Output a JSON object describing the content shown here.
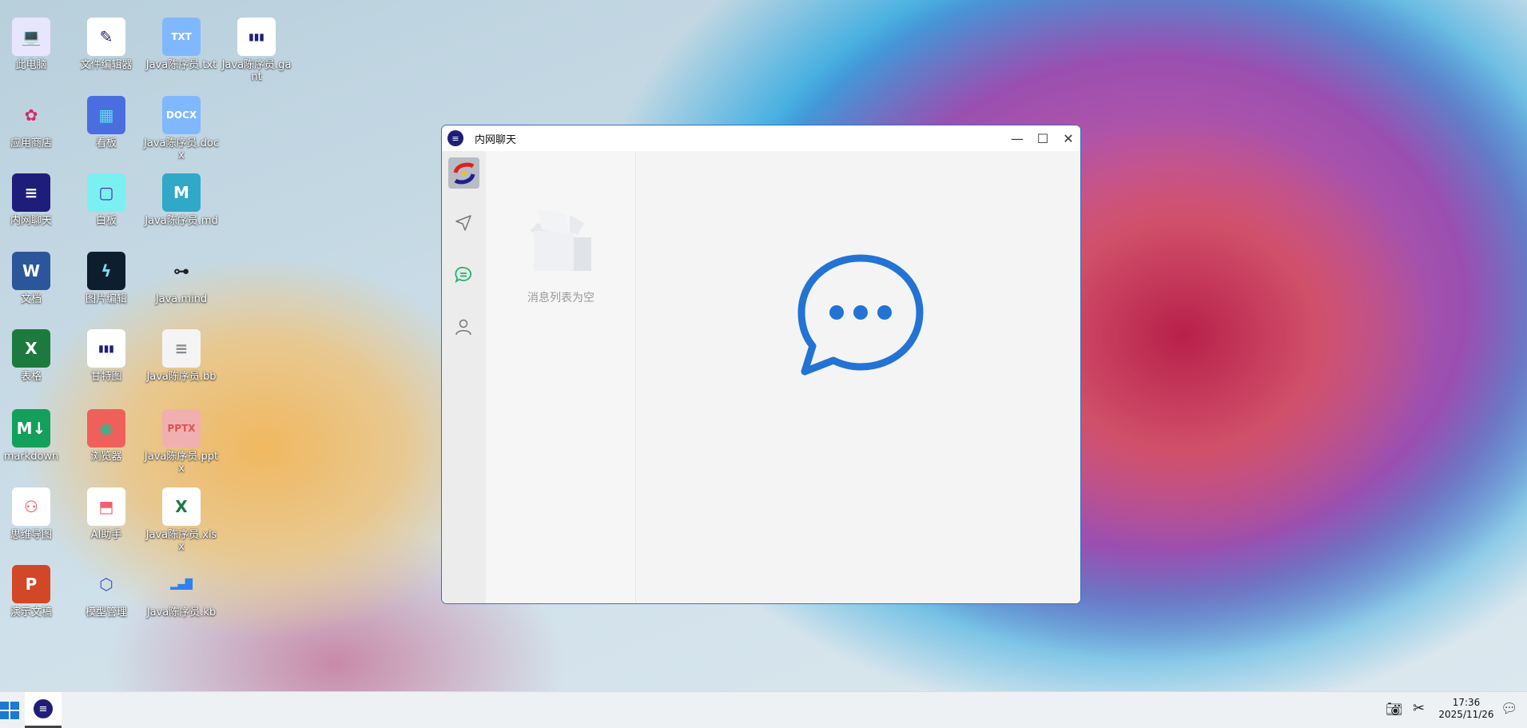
{
  "desktop": {
    "icons": [
      {
        "label": "此电脑",
        "glyph": "💻",
        "bg": "#e8e6ff",
        "fg": "#6b6bf0"
      },
      {
        "label": "应用商店",
        "glyph": "✿",
        "bg": "transparent",
        "fg": "#d4286a"
      },
      {
        "label": "内网聊天",
        "glyph": "≡",
        "bg": "#1e1e7a",
        "fg": "#fff"
      },
      {
        "label": "文档",
        "glyph": "W",
        "bg": "#2b579a",
        "fg": "#fff"
      },
      {
        "label": "表格",
        "glyph": "X",
        "bg": "#1d7a3e",
        "fg": "#fff"
      },
      {
        "label": "markdown",
        "glyph": "M↓",
        "bg": "#12a05a",
        "fg": "#fff"
      },
      {
        "label": "思维导图",
        "glyph": "⚇",
        "bg": "#fff",
        "fg": "#e04848"
      },
      {
        "label": "演示文稿",
        "glyph": "P",
        "bg": "#d24726",
        "fg": "#fff"
      },
      {
        "label": "文件编辑器",
        "glyph": "✎",
        "bg": "#fff",
        "fg": "#1e1e6a"
      },
      {
        "label": "看板",
        "glyph": "▦",
        "bg": "#4a6ee0",
        "fg": "#5ee0e0"
      },
      {
        "label": "白板",
        "glyph": "▢",
        "bg": "#7af0f0",
        "fg": "#5020b0"
      },
      {
        "label": "图片编辑",
        "glyph": "ϟ",
        "bg": "#0e1e2e",
        "fg": "#7ae0f0"
      },
      {
        "label": "甘特图",
        "glyph": "▮▮▮",
        "bg": "#fff",
        "fg": "#1e1e7a"
      },
      {
        "label": "浏览器",
        "glyph": "◉",
        "bg": "#f0605a",
        "fg": "#2ab890"
      },
      {
        "label": "AI助手",
        "glyph": "⬒",
        "bg": "#fff",
        "fg": "#f06070"
      },
      {
        "label": "模型管理",
        "glyph": "⬡",
        "bg": "transparent",
        "fg": "#4050c0"
      },
      {
        "label": "Java陈序员.txt",
        "glyph": "TXT",
        "bg": "#80b8ff",
        "fg": "#fff"
      },
      {
        "label": "Java陈序员.docx",
        "glyph": "DOCX",
        "bg": "#80b8ff",
        "fg": "#fff"
      },
      {
        "label": "Java陈序员.md",
        "glyph": "M",
        "bg": "#30a8c8",
        "fg": "#fff"
      },
      {
        "label": "Java.mind",
        "glyph": "⊶",
        "bg": "transparent",
        "fg": "#222"
      },
      {
        "label": "Java陈序员.bb",
        "glyph": "≡",
        "bg": "#f4f4f4",
        "fg": "#888"
      },
      {
        "label": "Java陈序员.pptx",
        "glyph": "PPTX",
        "bg": "#f0b0b0",
        "fg": "#e05050"
      },
      {
        "label": "Java陈序员.xlsx",
        "glyph": "X",
        "bg": "#fff",
        "fg": "#1d7a3e"
      },
      {
        "label": "Java陈序员.kb",
        "glyph": "▂▄█",
        "bg": "transparent",
        "fg": "#3080f0"
      },
      {
        "label": "Java陈序员.gant",
        "glyph": "▮▮▮",
        "bg": "#fff",
        "fg": "#1e1e7a"
      }
    ]
  },
  "window": {
    "title": "内网聊天",
    "minimize": "—",
    "maximize": "☐",
    "close": "✕",
    "empty_text": "消息列表为空",
    "accent": "#2273d4",
    "active_nav": "#1fb86a"
  },
  "taskbar": {
    "time": "17:36",
    "date": "2025/11/26"
  }
}
